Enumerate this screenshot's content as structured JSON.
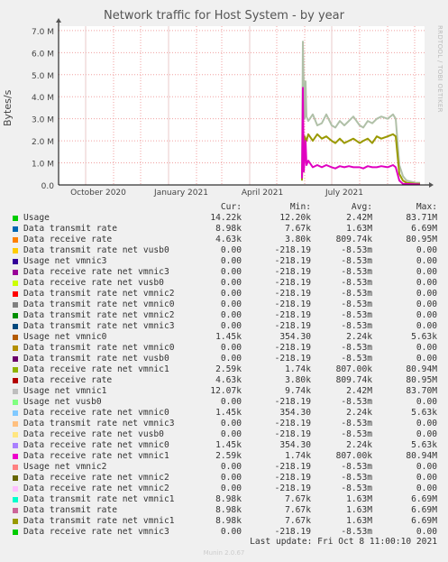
{
  "chart_data": {
    "type": "line",
    "title": "Network traffic for Host System - by year",
    "ylabel": "Bytes/s",
    "ylim": [
      0,
      7200000
    ],
    "yticks": [
      {
        "value": 0,
        "label": "0.0"
      },
      {
        "value": 1000000,
        "label": "1.0 M"
      },
      {
        "value": 2000000,
        "label": "2.0 M"
      },
      {
        "value": 3000000,
        "label": "3.0 M"
      },
      {
        "value": 4000000,
        "label": "4.0 M"
      },
      {
        "value": 5000000,
        "label": "5.0 M"
      },
      {
        "value": 6000000,
        "label": "6.0 M"
      },
      {
        "value": 7000000,
        "label": "7.0 M"
      }
    ],
    "xlim": [
      "2020-09-01",
      "2021-10-12"
    ],
    "xticks": [
      {
        "value": "2020-10-01",
        "label": "October 2020"
      },
      {
        "value": "2021-01-01",
        "label": "January 2021"
      },
      {
        "value": "2021-04-01",
        "label": "April 2021"
      },
      {
        "value": "2021-07-01",
        "label": "July 2021"
      }
    ],
    "grid": true,
    "series": [
      {
        "name": "Usage net vmnic1",
        "color": "#b0c0a8",
        "points": [
          [
            "2021-05-29",
            0.2
          ],
          [
            "2021-05-30",
            6.5
          ],
          [
            "2021-05-31",
            4.5
          ],
          [
            "2021-06-01",
            3.0
          ],
          [
            "2021-06-02",
            4.7
          ],
          [
            "2021-06-03",
            3.1
          ],
          [
            "2021-06-05",
            2.9
          ],
          [
            "2021-06-10",
            3.2
          ],
          [
            "2021-06-15",
            2.7
          ],
          [
            "2021-06-20",
            2.8
          ],
          [
            "2021-06-25",
            3.2
          ],
          [
            "2021-07-01",
            2.7
          ],
          [
            "2021-07-05",
            2.6
          ],
          [
            "2021-07-10",
            2.9
          ],
          [
            "2021-07-15",
            2.7
          ],
          [
            "2021-07-20",
            2.9
          ],
          [
            "2021-07-25",
            3.1
          ],
          [
            "2021-08-01",
            2.7
          ],
          [
            "2021-08-05",
            2.6
          ],
          [
            "2021-08-10",
            2.9
          ],
          [
            "2021-08-15",
            2.8
          ],
          [
            "2021-08-20",
            3.0
          ],
          [
            "2021-08-25",
            3.1
          ],
          [
            "2021-09-01",
            3.0
          ],
          [
            "2021-09-07",
            3.2
          ],
          [
            "2021-09-10",
            3.0
          ],
          [
            "2021-09-14",
            0.9
          ],
          [
            "2021-09-18",
            0.4
          ],
          [
            "2021-09-22",
            0.2
          ],
          [
            "2021-09-27",
            0.15
          ],
          [
            "2021-10-02",
            0.1
          ],
          [
            "2021-10-07",
            0.1
          ]
        ]
      },
      {
        "name": "Data transmit rate net vmnic1",
        "color": "#999900",
        "points": [
          [
            "2021-05-29",
            0.2
          ],
          [
            "2021-05-30",
            2.0
          ],
          [
            "2021-05-31",
            1.6
          ],
          [
            "2021-06-01",
            2.2
          ],
          [
            "2021-06-03",
            2.0
          ],
          [
            "2021-06-05",
            2.3
          ],
          [
            "2021-06-10",
            2.0
          ],
          [
            "2021-06-15",
            2.3
          ],
          [
            "2021-06-20",
            2.1
          ],
          [
            "2021-06-25",
            2.2
          ],
          [
            "2021-07-01",
            2.0
          ],
          [
            "2021-07-05",
            1.9
          ],
          [
            "2021-07-10",
            2.1
          ],
          [
            "2021-07-15",
            1.9
          ],
          [
            "2021-07-20",
            2.0
          ],
          [
            "2021-07-25",
            2.1
          ],
          [
            "2021-08-01",
            1.9
          ],
          [
            "2021-08-05",
            2.0
          ],
          [
            "2021-08-10",
            2.1
          ],
          [
            "2021-08-15",
            1.9
          ],
          [
            "2021-08-20",
            2.2
          ],
          [
            "2021-08-25",
            2.1
          ],
          [
            "2021-09-01",
            2.2
          ],
          [
            "2021-09-07",
            2.3
          ],
          [
            "2021-09-10",
            2.2
          ],
          [
            "2021-09-14",
            0.5
          ],
          [
            "2021-09-18",
            0.2
          ],
          [
            "2021-09-22",
            0.1
          ],
          [
            "2021-10-02",
            0.05
          ],
          [
            "2021-10-07",
            0.05
          ]
        ]
      },
      {
        "name": "Data receive rate net vmnic1",
        "color": "#e000c0",
        "points": [
          [
            "2021-05-29",
            0.3
          ],
          [
            "2021-05-30",
            4.4
          ],
          [
            "2021-05-31",
            0.6
          ],
          [
            "2021-06-01",
            1.2
          ],
          [
            "2021-06-02",
            2.0
          ],
          [
            "2021-06-03",
            0.9
          ],
          [
            "2021-06-05",
            1.1
          ],
          [
            "2021-06-10",
            0.8
          ],
          [
            "2021-06-15",
            0.9
          ],
          [
            "2021-06-20",
            0.8
          ],
          [
            "2021-06-25",
            0.9
          ],
          [
            "2021-07-01",
            0.8
          ],
          [
            "2021-07-05",
            0.75
          ],
          [
            "2021-07-10",
            0.85
          ],
          [
            "2021-07-15",
            0.8
          ],
          [
            "2021-07-20",
            0.85
          ],
          [
            "2021-07-25",
            0.8
          ],
          [
            "2021-08-01",
            0.8
          ],
          [
            "2021-08-05",
            0.75
          ],
          [
            "2021-08-10",
            0.85
          ],
          [
            "2021-08-15",
            0.8
          ],
          [
            "2021-08-20",
            0.8
          ],
          [
            "2021-08-25",
            0.85
          ],
          [
            "2021-09-01",
            0.8
          ],
          [
            "2021-09-07",
            0.9
          ],
          [
            "2021-09-10",
            0.8
          ],
          [
            "2021-09-14",
            0.2
          ],
          [
            "2021-09-18",
            0.05
          ],
          [
            "2021-10-07",
            0.02
          ]
        ]
      }
    ]
  },
  "side_label": "RRDTOOL / TOBI OETIKER",
  "legend_header": {
    "cur": "Cur:",
    "min": "Min:",
    "avg": "Avg:",
    "max": "Max:"
  },
  "legend": [
    {
      "name": "Usage",
      "color": "#00cc00",
      "cur": "14.22k",
      "min": "12.20k",
      "avg": "2.42M",
      "max": "83.71M"
    },
    {
      "name": "Data transmit rate",
      "color": "#0066b3",
      "cur": "8.98k",
      "min": "7.67k",
      "avg": "1.63M",
      "max": "6.69M"
    },
    {
      "name": "Data receive rate",
      "color": "#ff8000",
      "cur": "4.63k",
      "min": "3.80k",
      "avg": "809.74k",
      "max": "80.95M"
    },
    {
      "name": "Data transmit rate net vusb0",
      "color": "#ffcc00",
      "cur": "0.00",
      "min": "-218.19",
      "avg": "-8.53m",
      "max": "0.00"
    },
    {
      "name": "Usage net vmnic3",
      "color": "#330099",
      "cur": "0.00",
      "min": "-218.19",
      "avg": "-8.53m",
      "max": "0.00"
    },
    {
      "name": "Data receive rate net vmnic3",
      "color": "#990099",
      "cur": "0.00",
      "min": "-218.19",
      "avg": "-8.53m",
      "max": "0.00"
    },
    {
      "name": "Data receive rate net vusb0",
      "color": "#ccff00",
      "cur": "0.00",
      "min": "-218.19",
      "avg": "-8.53m",
      "max": "0.00"
    },
    {
      "name": "Data transmit rate net vmnic2",
      "color": "#ff0000",
      "cur": "0.00",
      "min": "-218.19",
      "avg": "-8.53m",
      "max": "0.00"
    },
    {
      "name": "Data transmit rate net vmnic0",
      "color": "#808080",
      "cur": "0.00",
      "min": "-218.19",
      "avg": "-8.53m",
      "max": "0.00"
    },
    {
      "name": "Data transmit rate net vmnic2",
      "color": "#008f00",
      "cur": "0.00",
      "min": "-218.19",
      "avg": "-8.53m",
      "max": "0.00"
    },
    {
      "name": "Data transmit rate net vmnic3",
      "color": "#00487d",
      "cur": "0.00",
      "min": "-218.19",
      "avg": "-8.53m",
      "max": "0.00"
    },
    {
      "name": "Usage net vmnic0",
      "color": "#b35a00",
      "cur": "1.45k",
      "min": "354.30",
      "avg": "2.24k",
      "max": "5.63k"
    },
    {
      "name": "Data transmit rate net vmnic0",
      "color": "#b38f00",
      "cur": "0.00",
      "min": "-218.19",
      "avg": "-8.53m",
      "max": "0.00"
    },
    {
      "name": "Data transmit rate net vusb0",
      "color": "#6b006b",
      "cur": "0.00",
      "min": "-218.19",
      "avg": "-8.53m",
      "max": "0.00"
    },
    {
      "name": "Data receive rate net vmnic1",
      "color": "#8fb300",
      "cur": "2.59k",
      "min": "1.74k",
      "avg": "807.00k",
      "max": "80.94M"
    },
    {
      "name": "Data receive rate",
      "color": "#b30000",
      "cur": "4.63k",
      "min": "3.80k",
      "avg": "809.74k",
      "max": "80.95M"
    },
    {
      "name": "Usage net vmnic1",
      "color": "#bebebe",
      "cur": "12.07k",
      "min": "9.74k",
      "avg": "2.42M",
      "max": "83.70M"
    },
    {
      "name": "Usage net vusb0",
      "color": "#80ff80",
      "cur": "0.00",
      "min": "-218.19",
      "avg": "-8.53m",
      "max": "0.00"
    },
    {
      "name": "Data receive rate net vmnic0",
      "color": "#80c9ff",
      "cur": "1.45k",
      "min": "354.30",
      "avg": "2.24k",
      "max": "5.63k"
    },
    {
      "name": "Data transmit rate net vmnic3",
      "color": "#ffc080",
      "cur": "0.00",
      "min": "-218.19",
      "avg": "-8.53m",
      "max": "0.00"
    },
    {
      "name": "Data receive rate net vusb0",
      "color": "#ffe680",
      "cur": "0.00",
      "min": "-218.19",
      "avg": "-8.53m",
      "max": "0.00"
    },
    {
      "name": "Data receive rate net vmnic0",
      "color": "#aa80ff",
      "cur": "1.45k",
      "min": "354.30",
      "avg": "2.24k",
      "max": "5.63k"
    },
    {
      "name": "Data receive rate net vmnic1",
      "color": "#ee00cc",
      "cur": "2.59k",
      "min": "1.74k",
      "avg": "807.00k",
      "max": "80.94M"
    },
    {
      "name": "Usage net vmnic2",
      "color": "#ff8080",
      "cur": "0.00",
      "min": "-218.19",
      "avg": "-8.53m",
      "max": "0.00"
    },
    {
      "name": "Data receive rate net vmnic2",
      "color": "#666600",
      "cur": "0.00",
      "min": "-218.19",
      "avg": "-8.53m",
      "max": "0.00"
    },
    {
      "name": "Data receive rate net vmnic2",
      "color": "#ffbfff",
      "cur": "0.00",
      "min": "-218.19",
      "avg": "-8.53m",
      "max": "0.00"
    },
    {
      "name": "Data transmit rate net vmnic1",
      "color": "#00ffcc",
      "cur": "8.98k",
      "min": "7.67k",
      "avg": "1.63M",
      "max": "6.69M"
    },
    {
      "name": "Data transmit rate",
      "color": "#cc6699",
      "cur": "8.98k",
      "min": "7.67k",
      "avg": "1.63M",
      "max": "6.69M"
    },
    {
      "name": "Data transmit rate net vmnic1",
      "color": "#999900",
      "cur": "8.98k",
      "min": "7.67k",
      "avg": "1.63M",
      "max": "6.69M"
    },
    {
      "name": "Data receive rate net vmnic3",
      "color": "#00cc00",
      "cur": "0.00",
      "min": "-218.19",
      "avg": "-8.53m",
      "max": "0.00"
    }
  ],
  "last_update": "Last update: Fri Oct  8 11:00:10 2021",
  "footer": "Munin 2.0.67"
}
